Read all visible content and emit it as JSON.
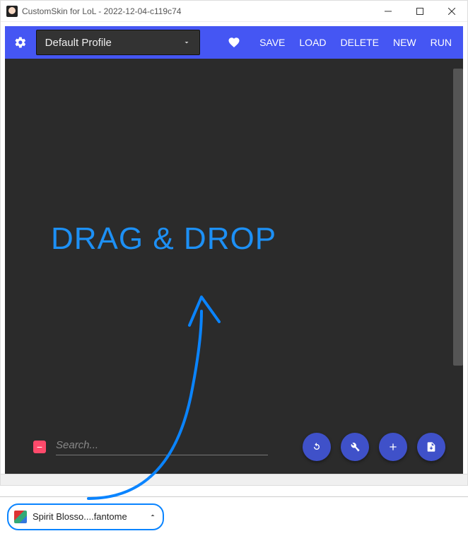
{
  "window": {
    "title": "CustomSkin for LoL - 2022-12-04-c119c74"
  },
  "toolbar": {
    "profile_label": "Default Profile",
    "save": "SAVE",
    "load": "LOAD",
    "delete": "DELETE",
    "new": "NEW",
    "run": "RUN"
  },
  "main": {
    "drag_drop_text": "DRAG & DROP"
  },
  "search": {
    "placeholder": "Search..."
  },
  "download": {
    "filename": "Spirit Blosso....fantome"
  },
  "colors": {
    "accent": "#4556f3",
    "annotation": "#0a84ff"
  }
}
